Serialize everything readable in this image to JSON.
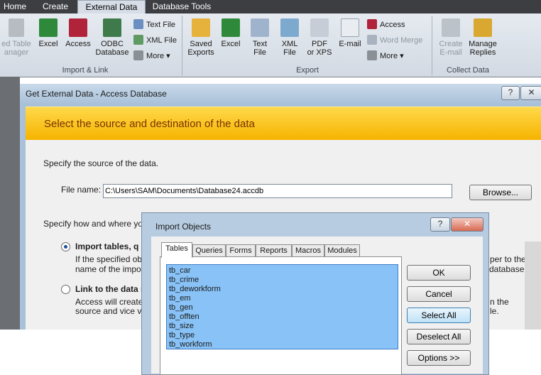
{
  "ribbon": {
    "tabs": [
      "Home",
      "Create",
      "External Data",
      "Database Tools"
    ],
    "active_tab": "External Data",
    "import_group": {
      "label": "Import & Link",
      "buttons": [
        "ed Table\nanager",
        "Excel",
        "Access",
        "ODBC\nDatabase"
      ],
      "small": [
        "Text File",
        "XML File",
        "More"
      ]
    },
    "export_group": {
      "label": "Export",
      "buttons": [
        "Saved\nExports",
        "Excel",
        "Text\nFile",
        "XML\nFile",
        "PDF\nor XPS",
        "E-mail"
      ],
      "small": [
        "Access",
        "Word Merge",
        "More"
      ]
    },
    "collect_group": {
      "label": "Collect Data",
      "buttons": [
        "Create\nE-mail",
        "Manage\nReplies"
      ]
    }
  },
  "main_dialog": {
    "title": "Get External Data - Access Database",
    "help": "?",
    "close": "✕",
    "banner": "Select the source and destination of the data",
    "source_text": "Specify the source of the data.",
    "file_label": "File name:",
    "file_value": "C:\\Users\\SAM\\Documents\\Database24.accdb",
    "browse_label": "Browse...",
    "how_text": "Specify how and where you w",
    "option1_title": "Import tables, q",
    "option1_line1": "If the specified obje",
    "option1_line2": "name of the importe",
    "option1_right1": "per to the",
    "option1_right2": "database.",
    "option2_title": "Link to the data s",
    "option2_line1": "Access will create a",
    "option2_line2": "source and vice ver",
    "option2_right1": "n the",
    "option2_right2": "le."
  },
  "import_dialog": {
    "title": "Import Objects",
    "help": "?",
    "close": "✕",
    "tabs": [
      "Tables",
      "Queries",
      "Forms",
      "Reports",
      "Macros",
      "Modules"
    ],
    "active_tab": "Tables",
    "tables": [
      "tb_car",
      "tb_crime",
      "tb_deworkform",
      "tb_em",
      "tb_gen",
      "tb_offten",
      "tb_size",
      "tb_type",
      "tb_workform"
    ],
    "buttons": {
      "ok": "OK",
      "cancel": "Cancel",
      "select_all": "Select All",
      "deselect_all": "Deselect All",
      "options": "Options >>"
    }
  },
  "colors": {
    "ribbon_dark": "#3c3e42",
    "banner_yellow": "#f6b300",
    "selection_blue": "#88c2f6",
    "banner_text": "#7a3200"
  }
}
